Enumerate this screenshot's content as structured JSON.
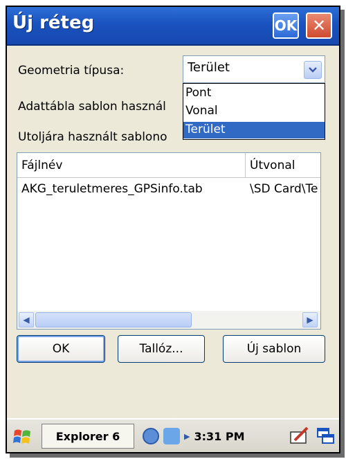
{
  "window": {
    "title": "Új réteg",
    "ok_label": "OK",
    "close_label": "✕"
  },
  "form": {
    "geometry_label": "Geometria típusa:",
    "template_label": "Adattábla sablon használ",
    "recent_label": "Utoljára használt sablono",
    "geometry_selected": "Terület",
    "geometry_options": [
      "Pont",
      "Vonal",
      "Terület"
    ]
  },
  "list": {
    "columns": [
      "Fájlnév",
      "Útvonal"
    ],
    "rows": [
      {
        "filename": "AKG_teruletmeres_GPSinfo.tab",
        "path": "\\SD Card\\Te"
      }
    ]
  },
  "buttons": {
    "ok": "OK",
    "browse": "Tallóz...",
    "new_template": "Új sablon"
  },
  "taskbar": {
    "app_label": "Explorer 6",
    "clock": "3:31 PM"
  },
  "colors": {
    "titlebar": "#1a52bf",
    "selection": "#316ac5",
    "dialog_bg": "#ece9d8"
  }
}
